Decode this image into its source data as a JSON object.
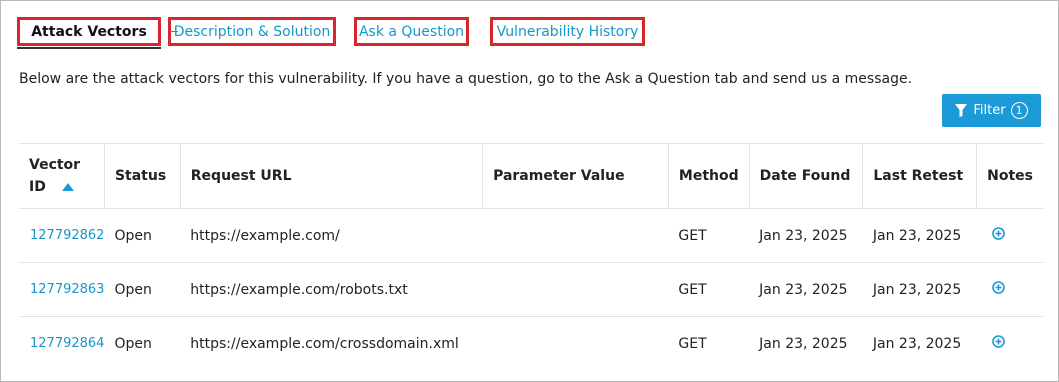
{
  "tabs": {
    "attack_vectors": "Attack Vectors",
    "description_solution": "Description & Solution",
    "ask_question": "Ask a Question",
    "vulnerability_history": "Vulnerability History"
  },
  "intro_text": "Below are the attack vectors for this vulnerability. If you have a question, go to the Ask a Question tab and send us a message.",
  "filter": {
    "label": "Filter",
    "count": "1"
  },
  "table": {
    "headers": {
      "vector_id_line1": "Vector",
      "vector_id_line2": "ID",
      "status": "Status",
      "request_url": "Request URL",
      "parameter_value": "Parameter Value",
      "method": "Method",
      "date_found": "Date Found",
      "last_retest": "Last Retest",
      "notes": "Notes"
    },
    "rows": [
      {
        "vector_id": "127792862",
        "status": "Open",
        "request_url": "https://example.com/",
        "parameter_value": "",
        "method": "GET",
        "date_found": "Jan 23, 2025",
        "last_retest": "Jan 23, 2025"
      },
      {
        "vector_id": "127792863",
        "status": "Open",
        "request_url": "https://example.com/robots.txt",
        "parameter_value": "",
        "method": "GET",
        "date_found": "Jan 23, 2025",
        "last_retest": "Jan 23, 2025"
      },
      {
        "vector_id": "127792864",
        "status": "Open",
        "request_url": "https://example.com/crossdomain.xml",
        "parameter_value": "",
        "method": "GET",
        "date_found": "Jan 23, 2025",
        "last_retest": "Jan 23, 2025"
      }
    ]
  },
  "icons": {
    "filter": "funnel-icon",
    "sort": "sort-ascending-icon",
    "add_note": "add-circle-icon"
  },
  "colors": {
    "accent": "#1a9ad6",
    "link": "#1996c8",
    "highlight_border": "#d9262c"
  }
}
